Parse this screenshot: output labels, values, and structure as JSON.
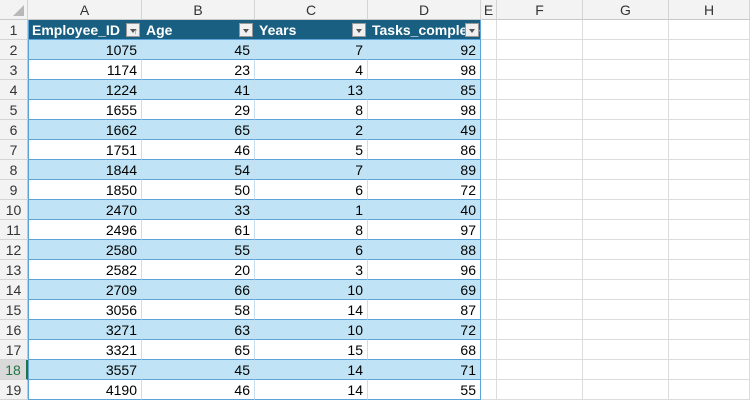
{
  "columns": [
    "A",
    "B",
    "C",
    "D",
    "E",
    "F",
    "G",
    "H"
  ],
  "headers": [
    "Employee_ID",
    "Age",
    "Years",
    "Tasks_completed"
  ],
  "header_display": [
    "Employee_ID",
    "Age",
    "Years",
    "Tasks_comple"
  ],
  "selected_row": 18,
  "rows": [
    [
      1075,
      45,
      7,
      92
    ],
    [
      1174,
      23,
      4,
      98
    ],
    [
      1224,
      41,
      13,
      85
    ],
    [
      1655,
      29,
      8,
      98
    ],
    [
      1662,
      65,
      2,
      49
    ],
    [
      1751,
      46,
      5,
      86
    ],
    [
      1844,
      54,
      7,
      89
    ],
    [
      1850,
      50,
      6,
      72
    ],
    [
      2470,
      33,
      1,
      40
    ],
    [
      2496,
      61,
      8,
      97
    ],
    [
      2580,
      55,
      6,
      88
    ],
    [
      2582,
      20,
      3,
      96
    ],
    [
      2709,
      66,
      10,
      69
    ],
    [
      3056,
      58,
      14,
      87
    ],
    [
      3271,
      63,
      10,
      72
    ],
    [
      3321,
      65,
      15,
      68
    ],
    [
      3557,
      45,
      14,
      71
    ],
    [
      4190,
      46,
      14,
      55
    ]
  ],
  "colors": {
    "header_bg": "#185f82",
    "band": "#c0e4f5",
    "selection": "#217346"
  }
}
